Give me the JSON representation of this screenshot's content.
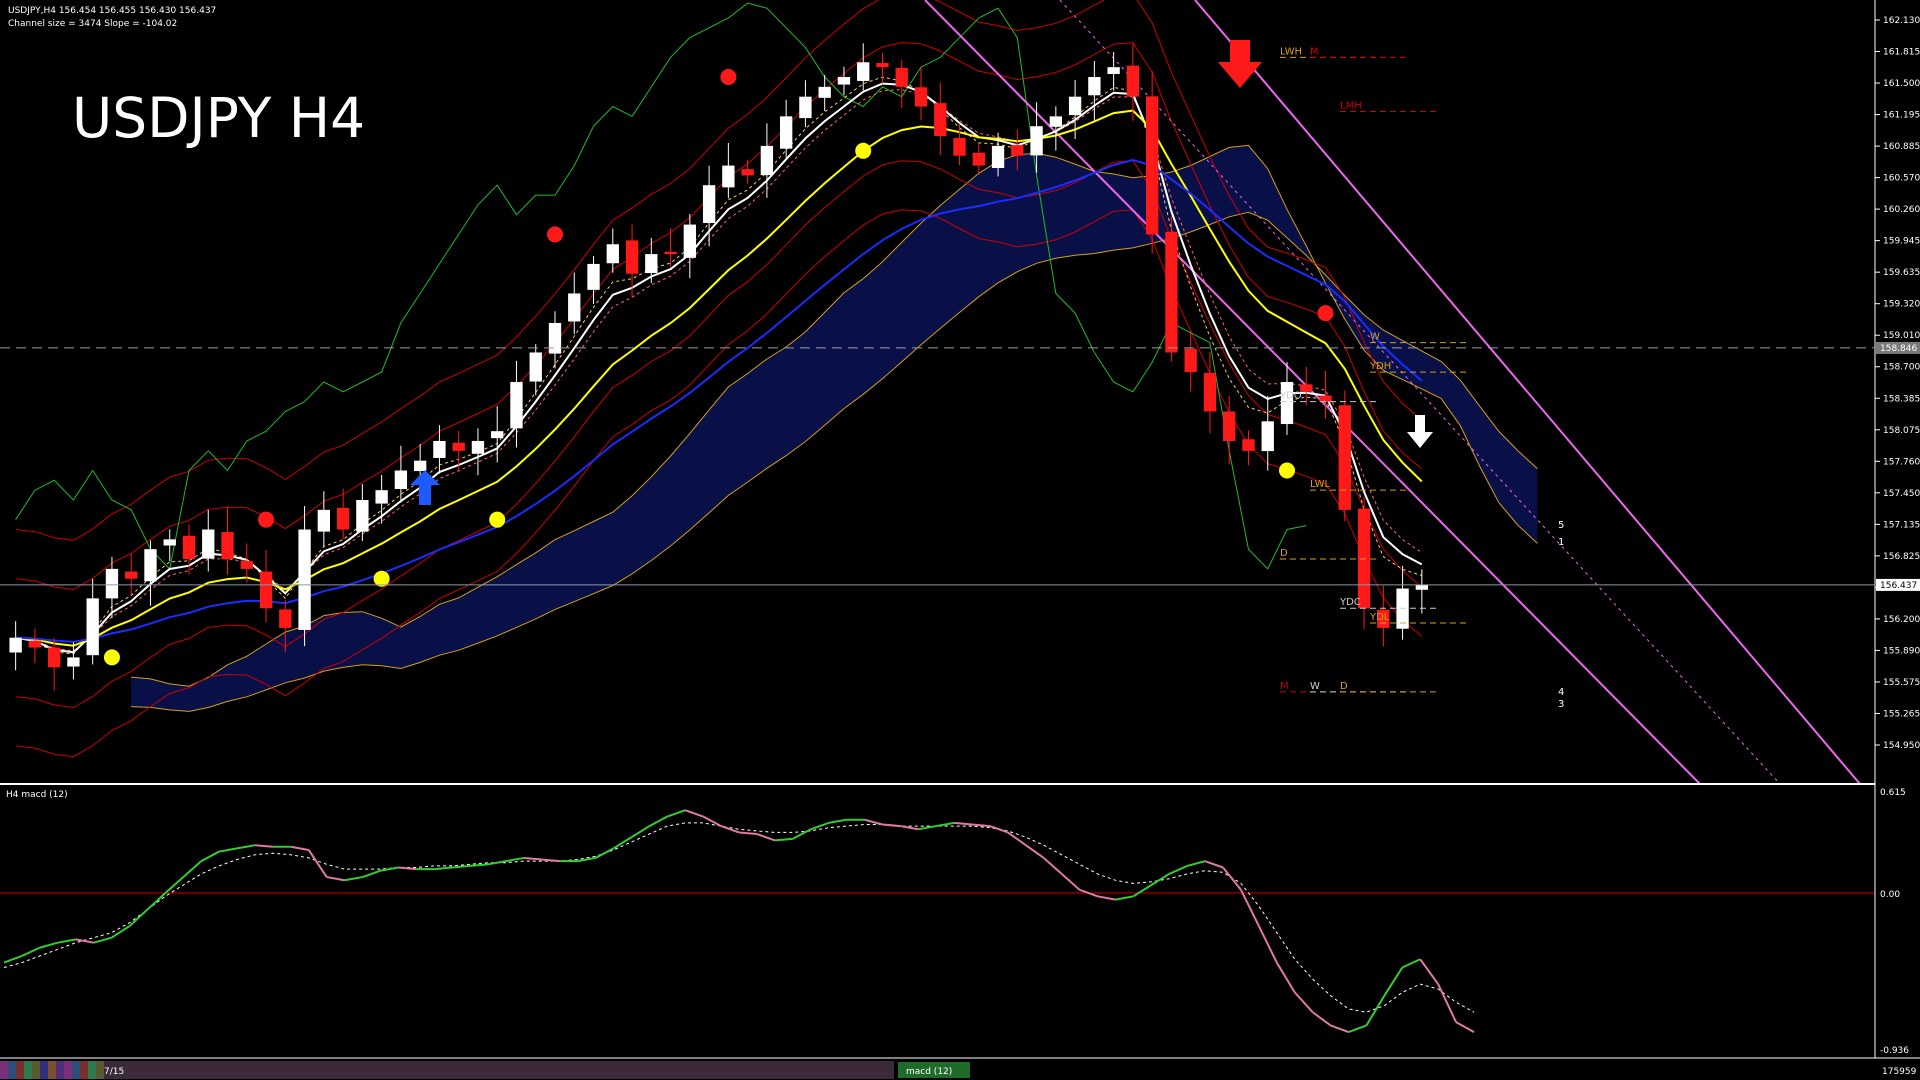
{
  "header": {
    "symbol_line": "USDJPY,H4  156.454 156.455 156.430 156.437",
    "channel_line": "Channel size = 3474 Slope = -104.02",
    "big_title": "USDJPY H4"
  },
  "indicator": {
    "title": "H4  macd (12)",
    "ticks": [
      "0.615",
      "0.00",
      "-0.936"
    ],
    "values": [
      -0.42,
      -0.38,
      -0.33,
      -0.3,
      -0.28,
      -0.3,
      -0.27,
      -0.2,
      -0.1,
      0.0,
      0.1,
      0.2,
      0.26,
      0.28,
      0.3,
      0.29,
      0.29,
      0.27,
      0.1,
      0.08,
      0.1,
      0.14,
      0.16,
      0.15,
      0.15,
      0.16,
      0.17,
      0.18,
      0.2,
      0.22,
      0.21,
      0.2,
      0.2,
      0.22,
      0.28,
      0.35,
      0.42,
      0.48,
      0.52,
      0.48,
      0.42,
      0.38,
      0.37,
      0.33,
      0.34,
      0.4,
      0.44,
      0.46,
      0.46,
      0.43,
      0.42,
      0.4,
      0.42,
      0.44,
      0.43,
      0.42,
      0.38,
      0.3,
      0.22,
      0.12,
      0.02,
      -0.02,
      -0.04,
      -0.02,
      0.05,
      0.12,
      0.17,
      0.2,
      0.16,
      0.02,
      -0.2,
      -0.42,
      -0.6,
      -0.72,
      -0.8,
      -0.84,
      -0.8,
      -0.62,
      -0.45,
      -0.4,
      -0.55,
      -0.78,
      -0.84
    ],
    "signal": [
      -0.45,
      -0.42,
      -0.38,
      -0.34,
      -0.3,
      -0.27,
      -0.24,
      -0.18,
      -0.1,
      -0.02,
      0.05,
      0.12,
      0.17,
      0.21,
      0.24,
      0.25,
      0.24,
      0.22,
      0.18,
      0.15,
      0.15,
      0.15,
      0.16,
      0.16,
      0.17,
      0.17,
      0.18,
      0.19,
      0.19,
      0.2,
      0.2,
      0.2,
      0.21,
      0.23,
      0.27,
      0.32,
      0.37,
      0.42,
      0.44,
      0.44,
      0.42,
      0.4,
      0.39,
      0.38,
      0.38,
      0.39,
      0.41,
      0.42,
      0.43,
      0.43,
      0.42,
      0.42,
      0.42,
      0.42,
      0.42,
      0.41,
      0.39,
      0.35,
      0.3,
      0.24,
      0.18,
      0.12,
      0.08,
      0.06,
      0.07,
      0.09,
      0.12,
      0.14,
      0.13,
      0.06,
      -0.08,
      -0.24,
      -0.4,
      -0.52,
      -0.62,
      -0.7,
      -0.72,
      -0.68,
      -0.6,
      -0.55,
      -0.58,
      -0.66,
      -0.72
    ],
    "zero_color": "#cc0000",
    "up_color": "#33cc33",
    "down_color": "#e07aa0"
  },
  "chart_data": {
    "type": "candlestick",
    "symbol": "USDJPY",
    "timeframe": "H4",
    "price_ticks": [
      "162.130",
      "161.815",
      "161.500",
      "161.195",
      "160.885",
      "160.570",
      "160.260",
      "159.945",
      "159.635",
      "159.320",
      "159.010",
      "158.700",
      "158.385",
      "158.075",
      "157.760",
      "157.450",
      "157.135",
      "156.825",
      "156.510",
      "156.200",
      "155.890",
      "155.575",
      "155.265",
      "154.950"
    ],
    "ylim": [
      154.84,
      162.2
    ],
    "current_price": "156.437",
    "dashed_level_price": "158.846",
    "current_price_value": 156.437,
    "dashed_level_value": 158.846,
    "closes": [
      155.9,
      155.8,
      155.6,
      155.7,
      156.3,
      156.6,
      156.5,
      156.8,
      156.9,
      156.7,
      157.0,
      156.7,
      156.6,
      156.2,
      156.0,
      157.0,
      157.2,
      157.0,
      157.3,
      157.4,
      157.6,
      157.7,
      157.9,
      157.8,
      157.9,
      158.0,
      158.5,
      158.8,
      159.1,
      159.4,
      159.7,
      159.9,
      159.6,
      159.8,
      159.8,
      160.1,
      160.5,
      160.7,
      160.6,
      160.9,
      161.2,
      161.4,
      161.5,
      161.6,
      161.75,
      161.7,
      161.5,
      161.3,
      161.0,
      160.8,
      160.7,
      160.9,
      160.8,
      161.1,
      161.2,
      161.4,
      161.6,
      161.7,
      161.4,
      160.0,
      158.8,
      158.6,
      158.2,
      157.9,
      157.8,
      158.1,
      158.5,
      158.4,
      158.3,
      157.2,
      156.2,
      156.0,
      156.4,
      156.44
    ],
    "highs_lows_note": "",
    "levels": [
      {
        "label": "LWH",
        "price": 161.8,
        "color": "#d4a017"
      },
      {
        "label": "M",
        "price": 161.8,
        "color": "#cc0000"
      },
      {
        "label": "LMH",
        "price": 161.25,
        "color": "#cc0000"
      },
      {
        "label": "YDH",
        "price": 158.6,
        "color": "#d4a017"
      },
      {
        "label": "YDO",
        "price": 158.3,
        "color": "#cccccc"
      },
      {
        "label": "LWL",
        "price": 157.4,
        "color": "#d4a017"
      },
      {
        "label": "YDC",
        "price": 156.2,
        "color": "#cccccc"
      },
      {
        "label": "YDL",
        "price": 156.05,
        "color": "#d4a017"
      },
      {
        "label": "M",
        "price": 155.35,
        "color": "#cc0000"
      },
      {
        "label": "W",
        "price": 155.35,
        "color": "#cccccc"
      },
      {
        "label": "D",
        "price": 155.35,
        "color": "#d4a017"
      },
      {
        "label": "W",
        "price": 158.9,
        "color": "#d4a017"
      },
      {
        "label": "D",
        "price": 156.7,
        "color": "#d4a017"
      }
    ],
    "projection_labels": [
      "5",
      "1",
      "4",
      "3"
    ],
    "bottom_date_label": "7/15",
    "volume_readout": "175959",
    "macd_tab_label": "macd (12)"
  },
  "colors": {
    "up_candle": "#ffffff",
    "down_candle": "#ff1a1a",
    "ema_white": "#ffffff",
    "ema_yellow": "#ffff00",
    "ema_blue": "#1a2cff",
    "bands_red": "#cc0000",
    "lagging_green": "#22bb22",
    "cloud_blue": "#1a2fcc",
    "cloud_yellow": "#d4a017",
    "channel_violet": "#ee66ee"
  }
}
